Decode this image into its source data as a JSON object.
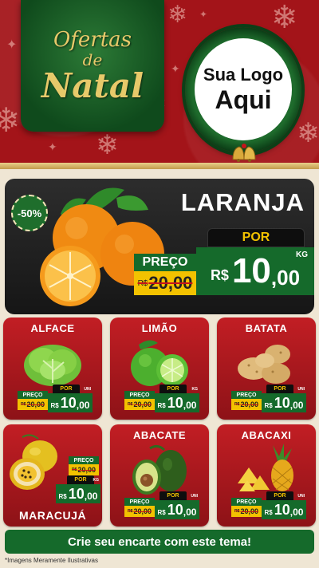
{
  "header": {
    "title_line1": "Ofertas",
    "title_line2": "de",
    "title_line3": "Natal",
    "logo_line1": "Sua Logo",
    "logo_line2": "Aqui"
  },
  "featured": {
    "discount": "-50%",
    "name": "LARANJA",
    "por_label": "POR",
    "preco_label": "PREÇO",
    "old_currency": "R$",
    "old_value": "20,00",
    "currency": "R$",
    "price_int": "10",
    "price_dec": ",00",
    "unit": "KG"
  },
  "cards": [
    {
      "name": "ALFACE",
      "preco": "PREÇO",
      "old": "20,00",
      "old_cur": "R$",
      "por": "POR",
      "cur": "R$",
      "int": "10",
      "dec": ",00",
      "unit": "UNI",
      "icon": "lettuce-icon"
    },
    {
      "name": "LIMÃO",
      "preco": "PREÇO",
      "old": "20,00",
      "old_cur": "R$",
      "por": "POR",
      "cur": "R$",
      "int": "10",
      "dec": ",00",
      "unit": "KG",
      "icon": "lime-icon"
    },
    {
      "name": "BATATA",
      "preco": "PREÇO",
      "old": "20,00",
      "old_cur": "R$",
      "por": "POR",
      "cur": "R$",
      "int": "10",
      "dec": ",00",
      "unit": "UNI",
      "icon": "potato-icon"
    },
    {
      "name": "MARACUJÁ",
      "preco": "PREÇO",
      "old": "20,00",
      "old_cur": "R$",
      "por": "POR",
      "cur": "R$",
      "int": "10",
      "dec": ",00",
      "unit": "KG",
      "icon": "passion-fruit-icon"
    },
    {
      "name": "ABACATE",
      "preco": "PREÇO",
      "old": "20,00",
      "old_cur": "R$",
      "por": "POR",
      "cur": "R$",
      "int": "10",
      "dec": ",00",
      "unit": "UNI",
      "icon": "avocado-icon"
    },
    {
      "name": "ABACAXI",
      "preco": "PREÇO",
      "old": "20,00",
      "old_cur": "R$",
      "por": "POR",
      "cur": "R$",
      "int": "10",
      "dec": ",00",
      "unit": "UNI",
      "icon": "pineapple-icon"
    }
  ],
  "cta": "Crie seu encarte com este tema!",
  "disclaimer": "*Imagens Meramente Ilustrativas",
  "colors": {
    "header_red": "#a31419",
    "green": "#156a2b",
    "yellow": "#f3c200",
    "card_red": "#c21e24",
    "gold": "#e7c96a"
  }
}
